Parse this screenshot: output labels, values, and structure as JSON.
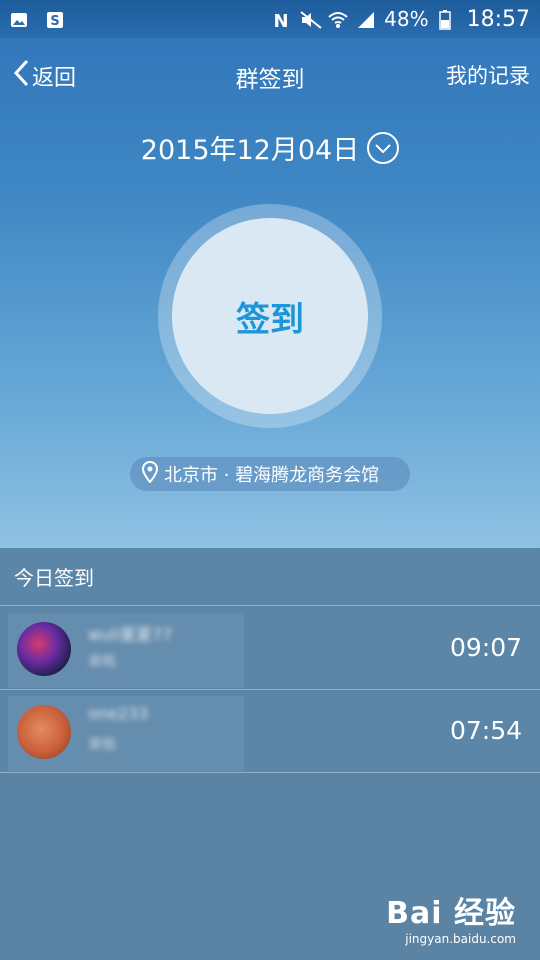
{
  "status_bar": {
    "battery": "48%",
    "time": "18:57",
    "icons": [
      "image-icon",
      "s-app-icon",
      "nfc-icon",
      "mute-icon",
      "wifi-icon",
      "signal-icon",
      "battery-icon"
    ]
  },
  "nav": {
    "back_label": "返回",
    "title": "群签到",
    "records_label": "我的记录"
  },
  "date": {
    "value": "2015年12月04日"
  },
  "sign_button": {
    "label": "签到"
  },
  "location": {
    "text": "北京市 · 碧海腾龙商务会馆"
  },
  "today": {
    "heading": "今日签到",
    "entries": [
      {
        "name": "wuli夏夏77",
        "sub": "来啦",
        "time": "09:07"
      },
      {
        "name": "one233",
        "sub": "来啦",
        "time": "07:54"
      }
    ]
  },
  "watermark": {
    "logo": "Bai 经验",
    "url": "jingyan.baidu.com"
  },
  "colors": {
    "accent": "#1d95d9",
    "list_bg": "#5c86a8",
    "gradient_top": "#2e73b8",
    "gradient_bottom": "#8fc1e3"
  }
}
